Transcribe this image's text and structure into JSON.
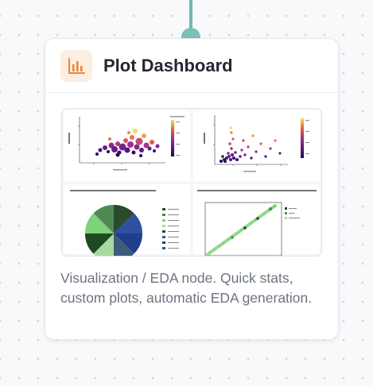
{
  "node": {
    "title": "Plot Dashboard",
    "description": "Visualization / EDA node. Quick stats, custom plots, automatic EDA generation.",
    "icon": "bar-chart-icon",
    "icon_color": "#e8873a",
    "icon_background": "#fdeee2",
    "connector_color": "#7cbfb8"
  }
}
